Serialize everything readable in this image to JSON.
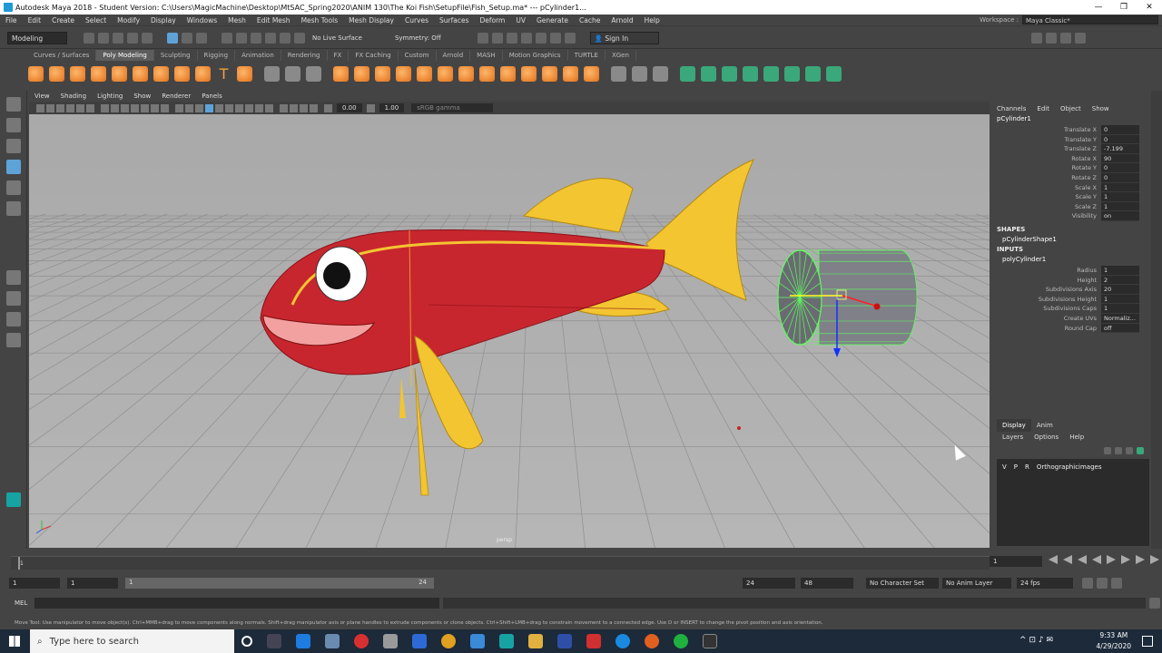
{
  "window": {
    "title": "Autodesk Maya 2018 - Student Version: C:\\Users\\MagicMachine\\Desktop\\MtSAC_Spring2020\\ANIM 130\\The Koi Fish\\SetupFile\\Fish_Setup.ma*   ---   pCylinder1...",
    "min": "—",
    "max": "❐",
    "close": "✕"
  },
  "menubar": {
    "items": [
      "File",
      "Edit",
      "Create",
      "Select",
      "Modify",
      "Display",
      "Windows",
      "Mesh",
      "Edit Mesh",
      "Mesh Tools",
      "Mesh Display",
      "Curves",
      "Surfaces",
      "Deform",
      "UV",
      "Generate",
      "Cache",
      "Arnold",
      "Help"
    ],
    "workspace_label": "Workspace :",
    "workspace_value": "Maya Classic*"
  },
  "statusline": {
    "mode": "Modeling",
    "live_surface": "No Live Surface",
    "symmetry": "Symmetry: Off",
    "sign_in": "Sign In"
  },
  "shelf_tabs": [
    "Curves / Surfaces",
    "Poly Modeling",
    "Sculpting",
    "Rigging",
    "Animation",
    "Rendering",
    "FX",
    "FX Caching",
    "Custom",
    "Arnold",
    "MASH",
    "Motion Graphics",
    "TURTLE",
    "XGen"
  ],
  "shelf_active": "Poly Modeling",
  "viewport": {
    "menu": [
      "View",
      "Shading",
      "Lighting",
      "Show",
      "Renderer",
      "Panels"
    ],
    "near": "0.00",
    "far": "1.00",
    "color_space": "sRGB gamma",
    "camera": "persp"
  },
  "channelbox": {
    "menu": [
      "Channels",
      "Edit",
      "Object",
      "Show"
    ],
    "object": "pCylinder1",
    "attributes": [
      {
        "name": "Translate X",
        "value": "0"
      },
      {
        "name": "Translate Y",
        "value": "0"
      },
      {
        "name": "Translate Z",
        "value": "-7.199"
      },
      {
        "name": "Rotate X",
        "value": "90"
      },
      {
        "name": "Rotate Y",
        "value": "0"
      },
      {
        "name": "Rotate Z",
        "value": "0"
      },
      {
        "name": "Scale X",
        "value": "1"
      },
      {
        "name": "Scale Y",
        "value": "1"
      },
      {
        "name": "Scale Z",
        "value": "1"
      },
      {
        "name": "Visibility",
        "value": "on"
      }
    ],
    "shapes_label": "SHAPES",
    "shape": "pCylinderShape1",
    "inputs_label": "INPUTS",
    "input": "polyCylinder1",
    "input_attributes": [
      {
        "name": "Radius",
        "value": "1"
      },
      {
        "name": "Height",
        "value": "2"
      },
      {
        "name": "Subdivisions Axis",
        "value": "20"
      },
      {
        "name": "Subdivisions Height",
        "value": "1"
      },
      {
        "name": "Subdivisions Caps",
        "value": "1"
      },
      {
        "name": "Create UVs",
        "value": "Normaliz..."
      },
      {
        "name": "Round Cap",
        "value": "off"
      }
    ]
  },
  "layers": {
    "tabs": [
      "Display",
      "Anim"
    ],
    "menu": [
      "Layers",
      "Options",
      "Help"
    ],
    "row": {
      "v": "V",
      "p": "P",
      "r": "R",
      "name": "Orthographicimages"
    }
  },
  "timeslider": {
    "current": "1",
    "end_field": "1"
  },
  "range": {
    "start": "1",
    "anim_start": "1",
    "slider_start": "1",
    "slider_end": "24",
    "anim_end_a": "24",
    "anim_end_b": "48",
    "character_set": "No Character Set",
    "anim_layer": "No Anim Layer",
    "fps": "24 fps"
  },
  "cmdline": {
    "label": "MEL"
  },
  "helpline": "Move Tool: Use manipulator to move object(s). Ctrl+MMB+drag to move components along normals. Shift+drag manipulator axis or plane handles to extrude components or clone objects. Ctrl+Shift+LMB+drag to constrain movement to a connected edge. Use D or INSERT to change the pivot position and axis orientation.",
  "taskbar": {
    "search_placeholder": "Type here to search",
    "time": "9:33 AM",
    "date": "4/29/2020"
  },
  "colors": {
    "fish_body": "#c8262e",
    "fish_fin": "#f3c531",
    "cylinder_wire": "#5cff5c",
    "accent_selection": "#5ea3d8"
  }
}
